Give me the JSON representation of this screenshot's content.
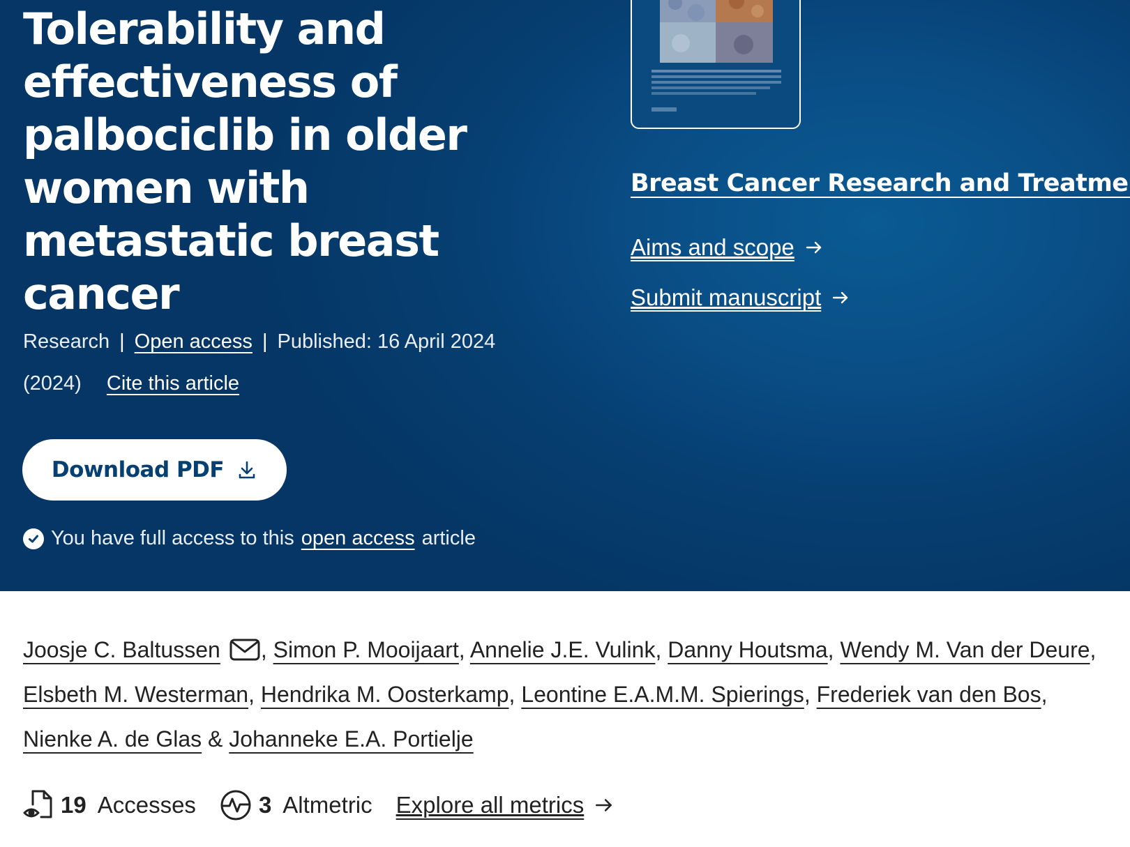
{
  "article": {
    "title": "Tolerability and effectiveness of palbociclib in older women with metastatic breast cancer",
    "type": "Research",
    "open_access_label": "Open access",
    "published": "Published: 16 April 2024",
    "year": "(2024)",
    "cite_label": "Cite this article",
    "download_label": "Download PDF",
    "access_note": {
      "prefix": "You have full access to this",
      "link": "open access",
      "suffix": "article"
    }
  },
  "journal": {
    "title": "Breast Cancer Research and Treatment",
    "aims_label": "Aims and scope",
    "submit_label": "Submit manuscript"
  },
  "authors": [
    "Joosje C. Baltussen",
    "Simon P. Mooijaart",
    "Annelie J.E. Vulink",
    "Danny Houtsma",
    "Wendy M. Van der Deure",
    "Elsbeth M. Westerman",
    "Hendrika M. Oosterkamp",
    "Leontine E.A.M.M. Spierings",
    "Frederiek van den Bos",
    "Nienke A. de Glas",
    "Johanneke E.A. Portielje"
  ],
  "metrics": {
    "accesses_count": "19",
    "accesses_label": "Accesses",
    "altmetric_count": "3",
    "altmetric_label": "Altmetric",
    "explore_label": "Explore all metrics"
  },
  "icons": {
    "download": "download-icon",
    "check": "check-circle-icon",
    "mail": "mail-icon",
    "arrow": "arrow-right-icon",
    "accesses": "document-eye-icon",
    "altmetric": "pulse-circle-icon"
  },
  "colors": {
    "hero_bg": "#063f72",
    "hero_text": "#ffffff",
    "button_text": "#063f72",
    "body_text": "#222222"
  }
}
